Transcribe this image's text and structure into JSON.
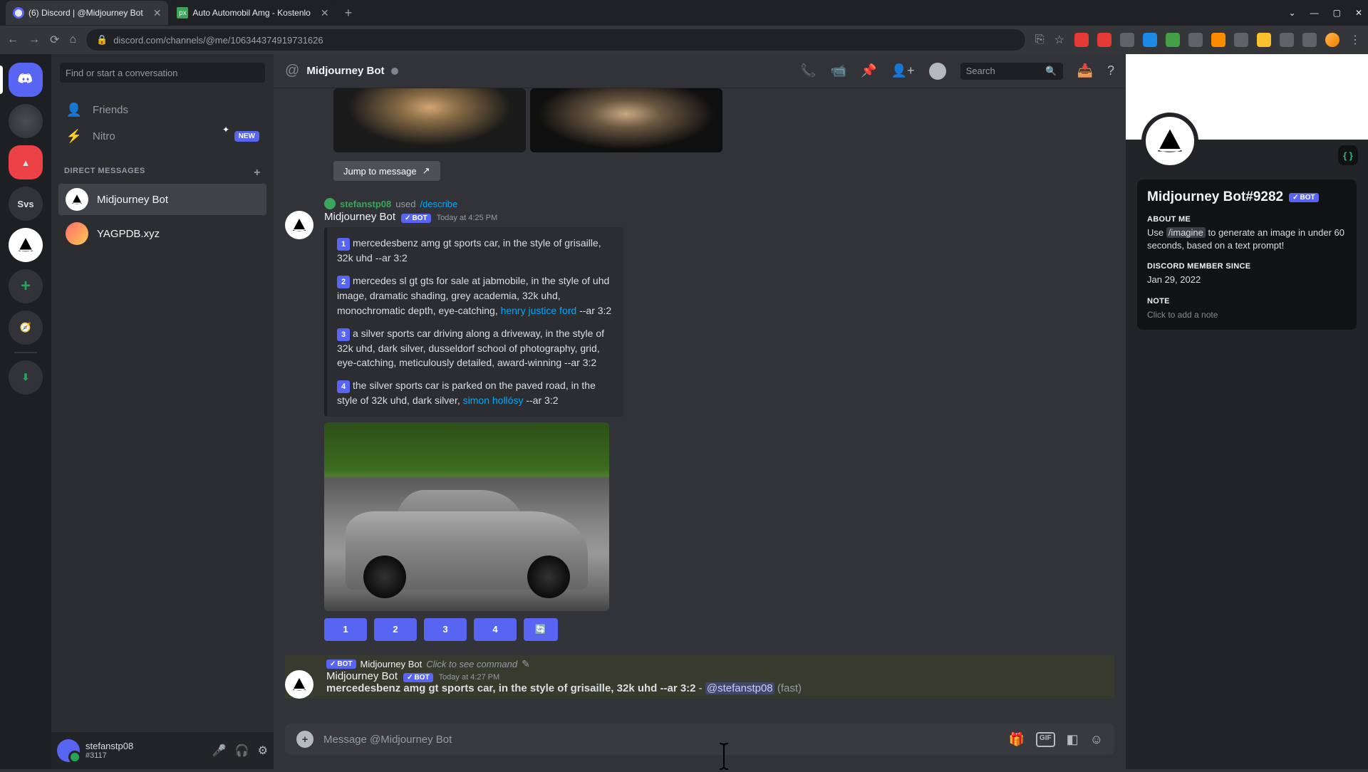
{
  "browser": {
    "tabs": [
      {
        "title": "(6) Discord | @Midjourney Bot",
        "favicon": "discord"
      },
      {
        "title": "Auto Automobil Amg - Kostenlo",
        "favicon": "px"
      }
    ],
    "url": "discord.com/channels/@me/106344374919731626"
  },
  "sidebar": {
    "search_placeholder": "Find or start a conversation",
    "friends": "Friends",
    "nitro": "Nitro",
    "nitro_badge": "NEW",
    "dm_header": "DIRECT MESSAGES",
    "dms": [
      {
        "name": "Midjourney Bot",
        "selected": true
      },
      {
        "name": "YAGPDB.xyz",
        "selected": false
      }
    ],
    "server_svs": "Svs"
  },
  "user": {
    "name": "stefanstp08",
    "discrim": "#3117"
  },
  "header": {
    "title": "Midjourney Bot",
    "search_placeholder": "Search"
  },
  "chat": {
    "jump": "Jump to message",
    "reply_user": "stefanstp08",
    "reply_used": "used",
    "reply_cmd": "/describe",
    "author": "Midjourney Bot",
    "bot_tag": "BOT",
    "time1": "Today at 4:25 PM",
    "desc1": "mercedesbenz amg gt sports car, in the style of grisaille, 32k uhd --ar 3:2",
    "desc2a": "mercedes sl gt gts for sale at jabmobile, in the style of uhd image, dramatic shading, grey academia, 32k uhd, monochromatic depth, eye-catching, ",
    "desc2_link": "henry justice ford",
    "desc2b": " --ar 3:2",
    "desc3": "a silver sports car driving along a driveway, in the style of 32k uhd, dark silver, dusseldorf school of photography, grid, eye-catching, meticulously detailed, award-winning --ar 3:2",
    "desc4a": "the silver sports car is parked on the paved road, in the style of 32k uhd, dark silver, ",
    "desc4_link": "simon hollósy",
    "desc4b": " --ar 3:2",
    "btn1": "1",
    "btn2": "2",
    "btn3": "3",
    "btn4": "4",
    "reply2_author": "Midjourney Bot",
    "reply2_hint": "Click to see command",
    "time2": "Today at 4:27 PM",
    "result_prompt": "mercedesbenz amg gt sports car, in the style of grisaille, 32k uhd --ar 3:2",
    "result_dash": " - ",
    "result_mention": "@stefanstp08",
    "result_fast": " (fast)"
  },
  "input": {
    "placeholder": "Message @Midjourney Bot"
  },
  "profile": {
    "name": "Midjourney Bot#9282",
    "about_head": "ABOUT ME",
    "about_pre": "Use ",
    "about_cmd": "/imagine",
    "about_post": " to generate an image in under 60 seconds, based on a text prompt!",
    "member_head": "DISCORD MEMBER SINCE",
    "member_date": "Jan 29, 2022",
    "note_head": "NOTE",
    "note_placeholder": "Click to add a note"
  }
}
